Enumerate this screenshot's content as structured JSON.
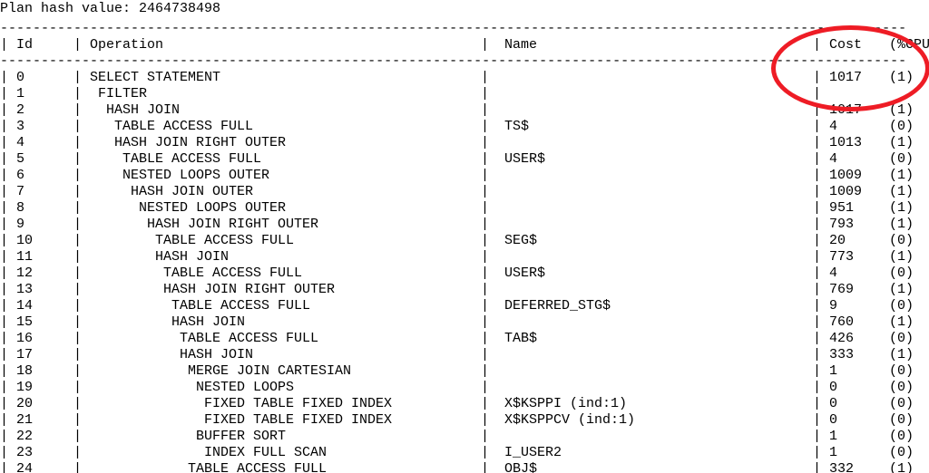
{
  "header": {
    "plan_hash_label": "Plan hash value: ",
    "plan_hash_value": "2464738498"
  },
  "dashes": "---------------------------------------------------------------------------------------------------------------",
  "columns": {
    "id": "Id",
    "operation": "Operation",
    "name": "Name",
    "cost": "Cost",
    "pcpu": "(%CPU)"
  },
  "rows": [
    {
      "id": "0",
      "op": "SELECT STATEMENT",
      "indent": 0,
      "name": "",
      "cost": "1017",
      "pcpu": "(1)"
    },
    {
      "id": "1",
      "op": "FILTER",
      "indent": 1,
      "name": "",
      "cost": "",
      "pcpu": ""
    },
    {
      "id": "2",
      "op": "HASH JOIN",
      "indent": 2,
      "name": "",
      "cost": "1017",
      "pcpu": "(1)"
    },
    {
      "id": "3",
      "op": "TABLE ACCESS FULL",
      "indent": 3,
      "name": "TS$",
      "cost": "4",
      "pcpu": "(0)"
    },
    {
      "id": "4",
      "op": "HASH JOIN RIGHT OUTER",
      "indent": 3,
      "name": "",
      "cost": "1013",
      "pcpu": "(1)"
    },
    {
      "id": "5",
      "op": "TABLE ACCESS FULL",
      "indent": 4,
      "name": "USER$",
      "cost": "4",
      "pcpu": "(0)"
    },
    {
      "id": "6",
      "op": "NESTED LOOPS OUTER",
      "indent": 4,
      "name": "",
      "cost": "1009",
      "pcpu": "(1)"
    },
    {
      "id": "7",
      "op": "HASH JOIN OUTER",
      "indent": 5,
      "name": "",
      "cost": "1009",
      "pcpu": "(1)"
    },
    {
      "id": "8",
      "op": "NESTED LOOPS OUTER",
      "indent": 6,
      "name": "",
      "cost": "951",
      "pcpu": "(1)"
    },
    {
      "id": "9",
      "op": "HASH JOIN RIGHT OUTER",
      "indent": 7,
      "name": "",
      "cost": "793",
      "pcpu": "(1)"
    },
    {
      "id": "10",
      "op": "TABLE ACCESS FULL",
      "indent": 8,
      "name": "SEG$",
      "cost": "20",
      "pcpu": "(0)"
    },
    {
      "id": "11",
      "op": "HASH JOIN",
      "indent": 8,
      "name": "",
      "cost": "773",
      "pcpu": "(1)"
    },
    {
      "id": "12",
      "op": "TABLE ACCESS FULL",
      "indent": 9,
      "name": "USER$",
      "cost": "4",
      "pcpu": "(0)"
    },
    {
      "id": "13",
      "op": "HASH JOIN RIGHT OUTER",
      "indent": 9,
      "name": "",
      "cost": "769",
      "pcpu": "(1)"
    },
    {
      "id": "14",
      "op": "TABLE ACCESS FULL",
      "indent": 10,
      "name": "DEFERRED_STG$",
      "cost": "9",
      "pcpu": "(0)"
    },
    {
      "id": "15",
      "op": "HASH JOIN",
      "indent": 10,
      "name": "",
      "cost": "760",
      "pcpu": "(1)"
    },
    {
      "id": "16",
      "op": "TABLE ACCESS FULL",
      "indent": 11,
      "name": "TAB$",
      "cost": "426",
      "pcpu": "(0)"
    },
    {
      "id": "17",
      "op": "HASH JOIN",
      "indent": 11,
      "name": "",
      "cost": "333",
      "pcpu": "(1)"
    },
    {
      "id": "18",
      "op": "MERGE JOIN CARTESIAN",
      "indent": 12,
      "name": "",
      "cost": "1",
      "pcpu": "(0)"
    },
    {
      "id": "19",
      "op": "NESTED LOOPS",
      "indent": 13,
      "name": "",
      "cost": "0",
      "pcpu": "(0)"
    },
    {
      "id": "20",
      "op": "FIXED TABLE FIXED INDEX",
      "indent": 14,
      "name": "X$KSPPI (ind:1)",
      "cost": "0",
      "pcpu": "(0)"
    },
    {
      "id": "21",
      "op": "FIXED TABLE FIXED INDEX",
      "indent": 14,
      "name": "X$KSPPCV (ind:1)",
      "cost": "0",
      "pcpu": "(0)"
    },
    {
      "id": "22",
      "op": "BUFFER SORT",
      "indent": 13,
      "name": "",
      "cost": "1",
      "pcpu": "(0)"
    },
    {
      "id": "23",
      "op": "INDEX FULL SCAN",
      "indent": 14,
      "name": "I_USER2",
      "cost": "1",
      "pcpu": "(0)"
    },
    {
      "id": "24",
      "op": "TABLE ACCESS FULL",
      "indent": 12,
      "name": "OBJ$",
      "cost": "332",
      "pcpu": "(1)"
    }
  ],
  "annotation": {
    "highlight": "cost-cpu-header",
    "color": "#ee1c25"
  }
}
